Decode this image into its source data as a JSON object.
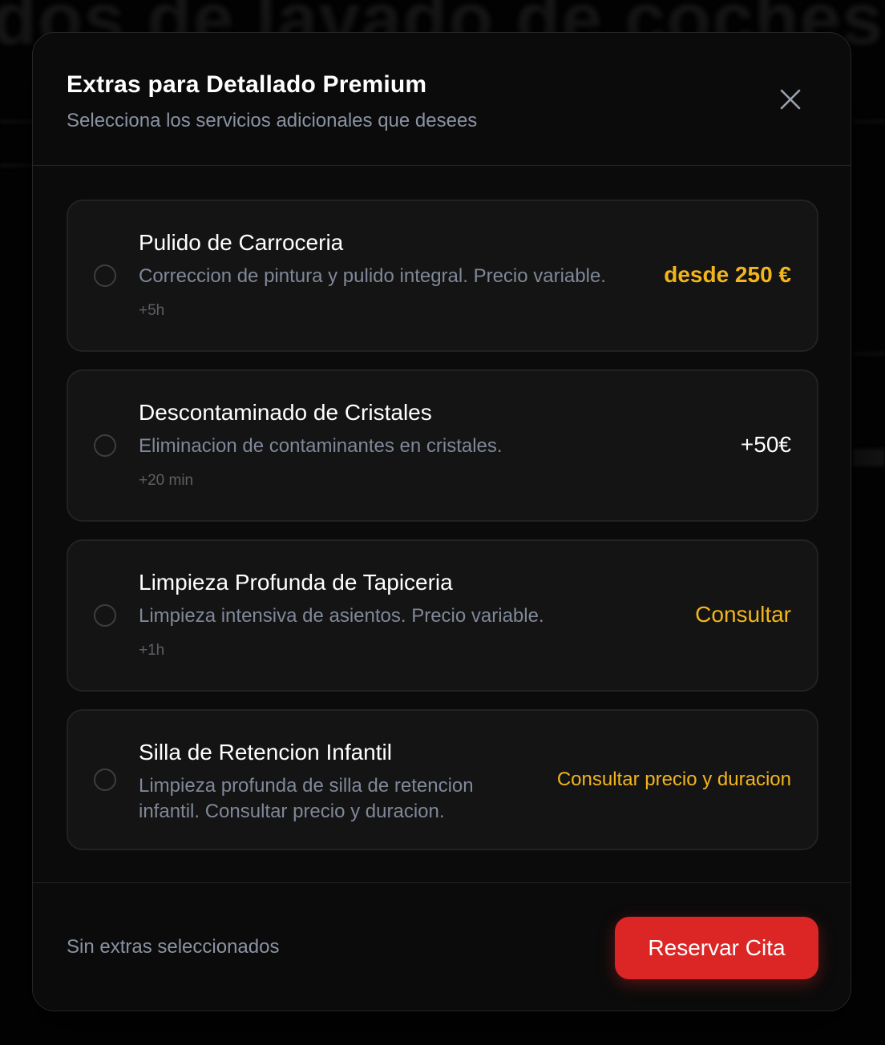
{
  "modal": {
    "title": "Extras para Detallado Premium",
    "subtitle": "Selecciona los servicios adicionales que desees",
    "close_icon": "close-icon"
  },
  "options": [
    {
      "name": "Pulido de Carroceria",
      "description": "Correccion de pintura y pulido integral. Precio variable.",
      "time": "+5h",
      "price": "desde 250 €",
      "price_color": "#f2b51c",
      "selected": false
    },
    {
      "name": "Descontaminado de Cristales",
      "description": "Eliminacion de contaminantes en cristales.",
      "time": "+20 min",
      "price": "+50€",
      "price_color": "#ffffff",
      "selected": false
    },
    {
      "name": "Limpieza Profunda de Tapiceria",
      "description": "Limpieza intensiva de asientos. Precio variable.",
      "time": "+1h",
      "price": "Consultar",
      "price_color": "#f2b51c",
      "selected": false
    },
    {
      "name": "Silla de Retencion Infantil",
      "description": "Limpieza profunda de silla de retencion infantil. Consultar precio y duracion.",
      "time": "",
      "price": "Consultar precio y duracion",
      "price_color": "#f2b51c",
      "selected": false
    }
  ],
  "footer": {
    "status": "Sin extras seleccionados",
    "reserve_label": "Reservar Cita",
    "reserve_color": "#dc2626"
  }
}
